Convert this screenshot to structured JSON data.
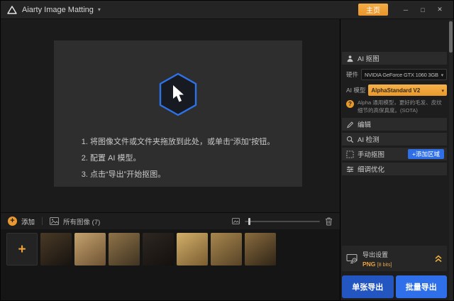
{
  "titlebar": {
    "app_title": "Aiarty Image Matting",
    "home_label": "主页",
    "controls": {
      "minimize": "─",
      "maximize": "□",
      "close": "✕"
    }
  },
  "dropzone": {
    "line1": "1. 将图像文件或文件夹拖放到此处，或单击“添加”按钮。",
    "line2": "2. 配置 AI 模型。",
    "line3": "3. 点击“导出”开始抠图。"
  },
  "toolbar": {
    "add_glyph": "+",
    "add_label": "添加",
    "all_images_label": "所有图像 (7)"
  },
  "filmstrip": {
    "add_plus": "+",
    "thumbnails": [
      {
        "c1": "#4a3a26",
        "c2": "#171310"
      },
      {
        "c1": "#c4a36e",
        "c2": "#6e5233"
      },
      {
        "c1": "#8f7348",
        "c2": "#3f3322"
      },
      {
        "c1": "#2e2722",
        "c2": "#14100d"
      },
      {
        "c1": "#d2b06a",
        "c2": "#7a5c30"
      },
      {
        "c1": "#a8874e",
        "c2": "#574327"
      },
      {
        "c1": "#8a6b3e",
        "c2": "#2f2517"
      }
    ]
  },
  "sidebar": {
    "ai_matting_title": "AI 抠图",
    "hardware_label": "硬件",
    "hardware_value": "NVIDIA GeForce GTX 1060 3GB",
    "ai_model_label": "AI 模型",
    "ai_model_value": "AlphaStandard  V2",
    "help_glyph": "?",
    "model_hint": "Alpha 通用模型，更好的毛发、皮纹细节的高保真度。(SOTA)",
    "edit_title": "编辑",
    "ai_detect_title": "AI 检测",
    "manual_title": "手动抠图",
    "manual_button": "+添加区域",
    "fine_tune_title": "细调优化",
    "export_title": "导出设置",
    "export_format": "PNG",
    "export_bits": "[8 bits]",
    "export_single": "单张导出",
    "export_batch": "批量导出"
  },
  "colors": {
    "accent_orange": "#eda23b",
    "accent_blue": "#2f70ea",
    "hexagon_border": "#2e72e8"
  }
}
